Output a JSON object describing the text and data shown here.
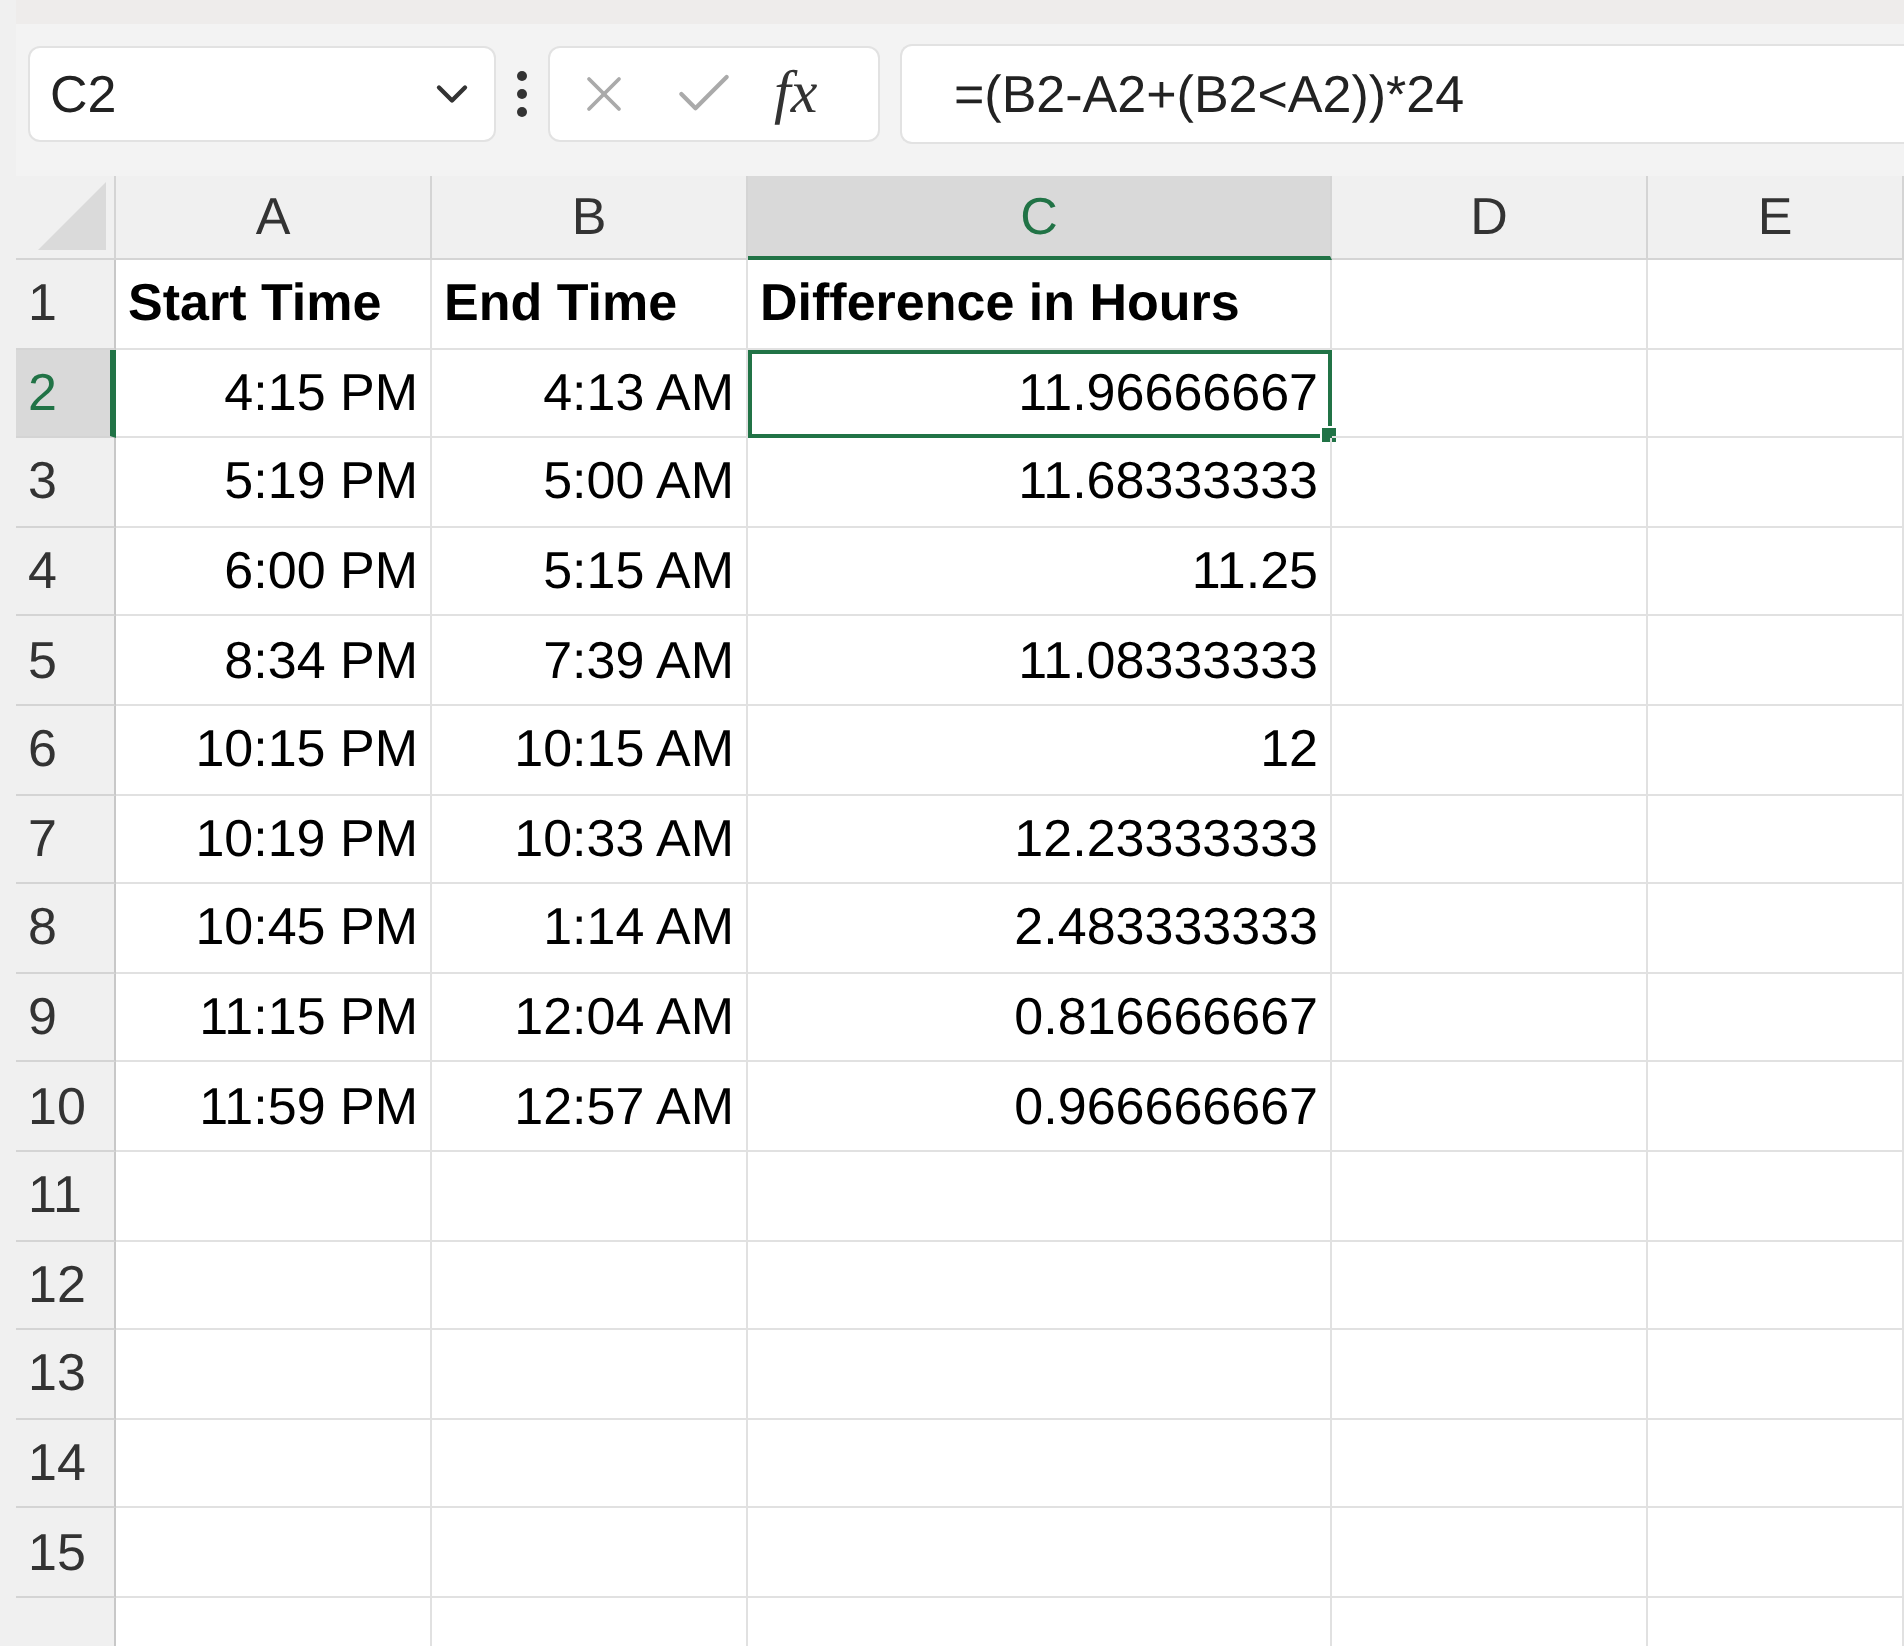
{
  "name_box": {
    "value": "C2"
  },
  "formula_bar": {
    "function_label": "fx",
    "formula": "=(B2-A2+(B2<A2))*24"
  },
  "columns": [
    {
      "label": "A",
      "selected": false
    },
    {
      "label": "B",
      "selected": false
    },
    {
      "label": "C",
      "selected": true
    },
    {
      "label": "D",
      "selected": false
    },
    {
      "label": "E",
      "selected": false
    }
  ],
  "rows": [
    {
      "number": "1",
      "selected": false,
      "kind": "header",
      "cells": [
        "Start Time",
        "End Time",
        "Difference in Hours"
      ]
    },
    {
      "number": "2",
      "selected": true,
      "kind": "data",
      "cells": [
        "4:15 PM",
        "4:13 AM",
        "11.96666667"
      ]
    },
    {
      "number": "3",
      "selected": false,
      "kind": "data",
      "cells": [
        "5:19 PM",
        "5:00 AM",
        "11.68333333"
      ]
    },
    {
      "number": "4",
      "selected": false,
      "kind": "data",
      "cells": [
        "6:00 PM",
        "5:15 AM",
        "11.25"
      ]
    },
    {
      "number": "5",
      "selected": false,
      "kind": "data",
      "cells": [
        "8:34 PM",
        "7:39 AM",
        "11.08333333"
      ]
    },
    {
      "number": "6",
      "selected": false,
      "kind": "data",
      "cells": [
        "10:15 PM",
        "10:15 AM",
        "12"
      ]
    },
    {
      "number": "7",
      "selected": false,
      "kind": "data",
      "cells": [
        "10:19 PM",
        "10:33 AM",
        "12.23333333"
      ]
    },
    {
      "number": "8",
      "selected": false,
      "kind": "data",
      "cells": [
        "10:45 PM",
        "1:14 AM",
        "2.483333333"
      ]
    },
    {
      "number": "9",
      "selected": false,
      "kind": "data",
      "cells": [
        "11:15 PM",
        "12:04 AM",
        "0.816666667"
      ]
    },
    {
      "number": "10",
      "selected": false,
      "kind": "data",
      "cells": [
        "11:59 PM",
        "12:57 AM",
        "0.966666667"
      ]
    },
    {
      "number": "11",
      "selected": false,
      "kind": "data"
    },
    {
      "number": "12",
      "selected": false,
      "kind": "data"
    },
    {
      "number": "13",
      "selected": false,
      "kind": "data"
    },
    {
      "number": "14",
      "selected": false,
      "kind": "data"
    },
    {
      "number": "15",
      "selected": false,
      "kind": "data"
    },
    {
      "selected": false,
      "kind": "data"
    }
  ]
}
